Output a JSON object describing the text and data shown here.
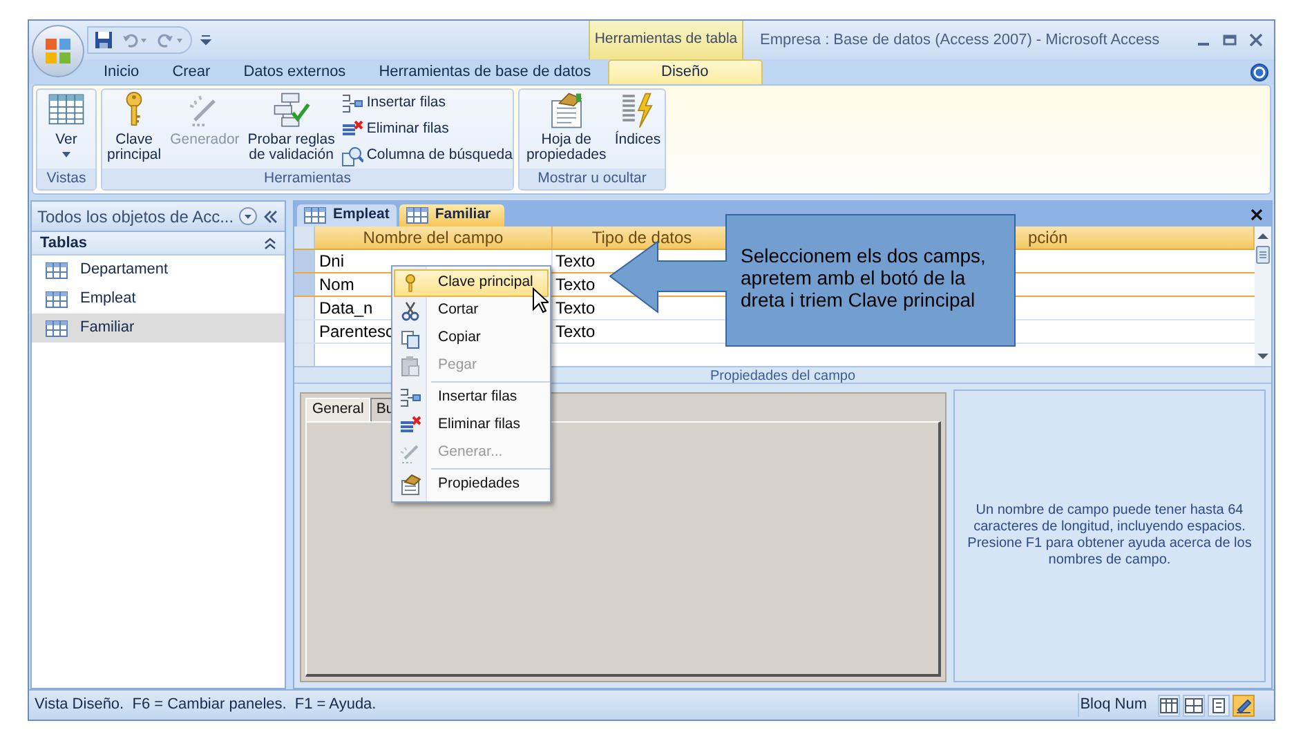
{
  "window": {
    "title": "Empresa : Base de datos (Access 2007) - Microsoft Access",
    "context_group": "Herramientas de tabla"
  },
  "ribbon_tabs": [
    {
      "label": "Inicio",
      "selected": false
    },
    {
      "label": "Crear",
      "selected": false
    },
    {
      "label": "Datos externos",
      "selected": false
    },
    {
      "label": "Herramientas de base de datos",
      "selected": false
    },
    {
      "label": "Diseño",
      "selected": true
    }
  ],
  "ribbon_groups": [
    {
      "label": "Vistas",
      "commands": [
        {
          "kind": "large",
          "label": "Ver",
          "dropdown": true,
          "disabled": false
        }
      ]
    },
    {
      "label": "Herramientas",
      "commands": [
        {
          "kind": "large",
          "label": "Clave principal",
          "disabled": false
        },
        {
          "kind": "large",
          "label": "Generador",
          "disabled": true
        },
        {
          "kind": "large",
          "label": "Probar reglas de validación",
          "disabled": false
        },
        {
          "kind": "small",
          "label": "Insertar filas",
          "disabled": false
        },
        {
          "kind": "small",
          "label": "Eliminar filas",
          "disabled": false
        },
        {
          "kind": "small",
          "label": "Columna de búsqueda",
          "disabled": false
        }
      ]
    },
    {
      "label": "Mostrar u ocultar",
      "commands": [
        {
          "kind": "large",
          "label": "Hoja de propiedades",
          "disabled": false
        },
        {
          "kind": "large",
          "label": "Índices",
          "disabled": false
        }
      ]
    }
  ],
  "navigation": {
    "title": "Todos los objetos de Acc...",
    "section": "Tablas",
    "items": [
      {
        "label": "Departament",
        "selected": false
      },
      {
        "label": "Empleat",
        "selected": false
      },
      {
        "label": "Familiar",
        "selected": true
      }
    ]
  },
  "document_tabs": [
    {
      "label": "Empleat",
      "selected": false
    },
    {
      "label": "Familiar",
      "selected": true
    }
  ],
  "grid": {
    "columns": [
      "Nombre del campo",
      "Tipo de datos",
      "pción"
    ],
    "rows": [
      {
        "field": "Dni",
        "type": "Texto",
        "selected": true
      },
      {
        "field": "Nom",
        "type": "Texto",
        "selected": true
      },
      {
        "field": "Data_n",
        "type": "Texto",
        "selected": false
      },
      {
        "field": "Parentesc",
        "type": "Texto",
        "selected": false
      }
    ]
  },
  "properties": {
    "title": "Propiedades del campo",
    "tabs": [
      {
        "label": "General",
        "selected": true
      },
      {
        "label": "Bu",
        "selected": false
      }
    ],
    "help": "Un nombre de campo puede tener hasta 64 caracteres de longitud, incluyendo espacios. Presione F1 para obtener ayuda acerca de los nombres de campo."
  },
  "context_menu": [
    {
      "label": "Clave principal",
      "highlighted": true,
      "disabled": false,
      "separator_before": false
    },
    {
      "label": "Cortar",
      "highlighted": false,
      "disabled": false,
      "separator_before": false
    },
    {
      "label": "Copiar",
      "highlighted": false,
      "disabled": false,
      "separator_before": false
    },
    {
      "label": "Pegar",
      "highlighted": false,
      "disabled": true,
      "separator_before": false
    },
    {
      "label": "Insertar filas",
      "highlighted": false,
      "disabled": false,
      "separator_before": true
    },
    {
      "label": "Eliminar filas",
      "highlighted": false,
      "disabled": false,
      "separator_before": false
    },
    {
      "label": "Generar...",
      "highlighted": false,
      "disabled": true,
      "separator_before": false
    },
    {
      "label": "Propiedades",
      "highlighted": false,
      "disabled": false,
      "separator_before": true
    }
  ],
  "callout": {
    "text": "Seleccionem els dos camps, apretem amb el botó de la dreta i triem Clave principal"
  },
  "status_bar": {
    "text": "Vista Diseño.  F6 = Cambiar paneles.  F1 = Ayuda.",
    "indicator": "Bloq Num",
    "views": [
      {
        "selected": false
      },
      {
        "selected": false
      },
      {
        "selected": false
      },
      {
        "selected": true
      }
    ]
  }
}
